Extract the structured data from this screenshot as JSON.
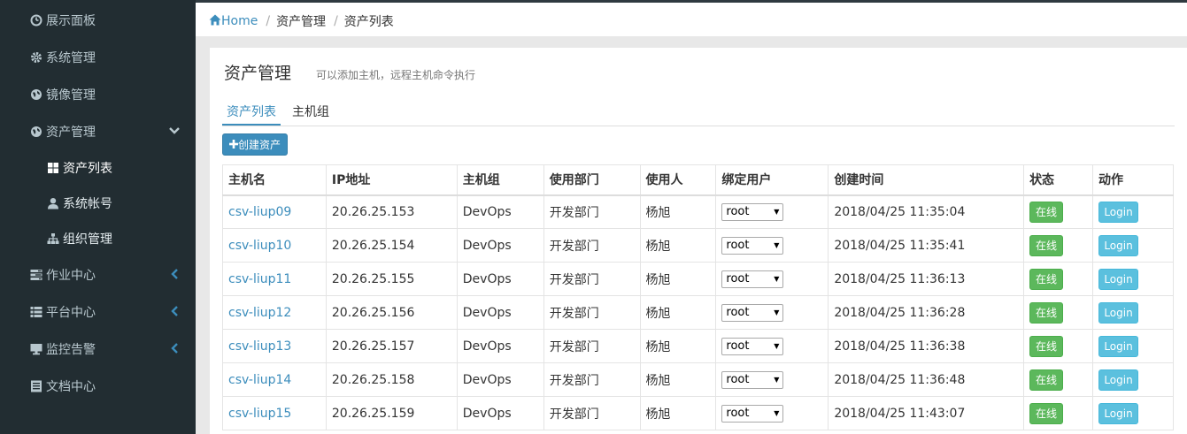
{
  "sidebar": {
    "items": [
      {
        "label": "展示面板",
        "icon": "dashboard-icon"
      },
      {
        "label": "系统管理",
        "icon": "gear-icon"
      },
      {
        "label": "镜像管理",
        "icon": "globe-icon"
      },
      {
        "label": "资产管理",
        "icon": "globe-icon"
      },
      {
        "label": "作业中心",
        "icon": "tasks-icon"
      },
      {
        "label": "平台中心",
        "icon": "list-icon"
      },
      {
        "label": "监控告警",
        "icon": "monitor-icon"
      },
      {
        "label": "文档中心",
        "icon": "book-icon"
      }
    ],
    "subitems": [
      {
        "label": "资产列表",
        "icon": "grid-icon"
      },
      {
        "label": "系统帐号",
        "icon": "user-icon"
      },
      {
        "label": "组织管理",
        "icon": "sitemap-icon"
      }
    ]
  },
  "breadcrumb": {
    "home": "Home",
    "items": [
      "资产管理",
      "资产列表"
    ]
  },
  "page": {
    "title": "资产管理",
    "subtitle": "可以添加主机，远程主机命令执行"
  },
  "tabs": [
    "资产列表",
    "主机组"
  ],
  "create_button": "创建资产",
  "table": {
    "headers": [
      "主机名",
      "IP地址",
      "主机组",
      "使用部门",
      "使用人",
      "绑定用户",
      "创建时间",
      "状态",
      "动作"
    ],
    "rows": [
      {
        "host": "csv-liup09",
        "ip": "20.26.25.153",
        "group": "DevOps",
        "dept": "开发部门",
        "user": "杨旭",
        "bind": "root",
        "created": "2018/04/25 11:35:04",
        "status": "在线",
        "action": "Login"
      },
      {
        "host": "csv-liup10",
        "ip": "20.26.25.154",
        "group": "DevOps",
        "dept": "开发部门",
        "user": "杨旭",
        "bind": "root",
        "created": "2018/04/25 11:35:41",
        "status": "在线",
        "action": "Login"
      },
      {
        "host": "csv-liup11",
        "ip": "20.26.25.155",
        "group": "DevOps",
        "dept": "开发部门",
        "user": "杨旭",
        "bind": "root",
        "created": "2018/04/25 11:36:13",
        "status": "在线",
        "action": "Login"
      },
      {
        "host": "csv-liup12",
        "ip": "20.26.25.156",
        "group": "DevOps",
        "dept": "开发部门",
        "user": "杨旭",
        "bind": "root",
        "created": "2018/04/25 11:36:28",
        "status": "在线",
        "action": "Login"
      },
      {
        "host": "csv-liup13",
        "ip": "20.26.25.157",
        "group": "DevOps",
        "dept": "开发部门",
        "user": "杨旭",
        "bind": "root",
        "created": "2018/04/25 11:36:38",
        "status": "在线",
        "action": "Login"
      },
      {
        "host": "csv-liup14",
        "ip": "20.26.25.158",
        "group": "DevOps",
        "dept": "开发部门",
        "user": "杨旭",
        "bind": "root",
        "created": "2018/04/25 11:36:48",
        "status": "在线",
        "action": "Login"
      },
      {
        "host": "csv-liup15",
        "ip": "20.26.25.159",
        "group": "DevOps",
        "dept": "开发部门",
        "user": "杨旭",
        "bind": "root",
        "created": "2018/04/25 11:43:07",
        "status": "在线",
        "action": "Login"
      }
    ]
  },
  "colors": {
    "sidebar_bg": "#222d32",
    "accent": "#3c8dbc",
    "online": "#5cb85c",
    "login": "#5bc0de"
  }
}
